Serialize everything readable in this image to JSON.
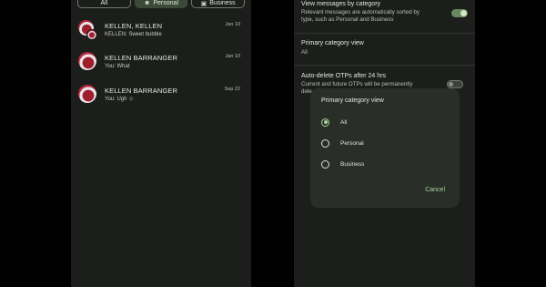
{
  "inbox": {
    "chips": [
      {
        "label": "All",
        "icon": "none",
        "selected": false
      },
      {
        "label": "Personal",
        "icon": "person-icon",
        "selected": true
      },
      {
        "label": "Business",
        "icon": "briefcase-icon",
        "selected": false
      }
    ],
    "conversations": [
      {
        "name": "KELLEN, KELLEN",
        "date": "Jan 10",
        "snippet": "KELLEN: Sweet bubble"
      },
      {
        "name": "KELLEN BARRANGER",
        "date": "Jan 10",
        "snippet": "You: What"
      },
      {
        "name": "KELLEN BARRANGER",
        "date": "Sep 22",
        "snippet": "You: Ugh ☺"
      }
    ]
  },
  "settings": {
    "view_by_category": {
      "title": "View messages by category",
      "subtitle_line1": "Relevant messages are automatically sorted by",
      "subtitle_line2": "type, such as Personal and Business",
      "enabled": true
    },
    "primary_category": {
      "title": "Primary category view",
      "value": "All"
    },
    "auto_delete": {
      "title": "Auto-delete OTPs after 24 hrs",
      "subtitle_line1": "Current and future OTPs will be permanently",
      "subtitle_line2": "dele",
      "enabled": false
    }
  },
  "dialog": {
    "title": "Primary category view",
    "options": [
      {
        "label": "All",
        "checked": true
      },
      {
        "label": "Personal",
        "checked": false
      },
      {
        "label": "Business",
        "checked": false
      }
    ],
    "cancel_label": "Cancel"
  },
  "colors": {
    "accent": "#a7d59a",
    "surface": "#1c1e1b",
    "dialog": "#2a2e28"
  }
}
